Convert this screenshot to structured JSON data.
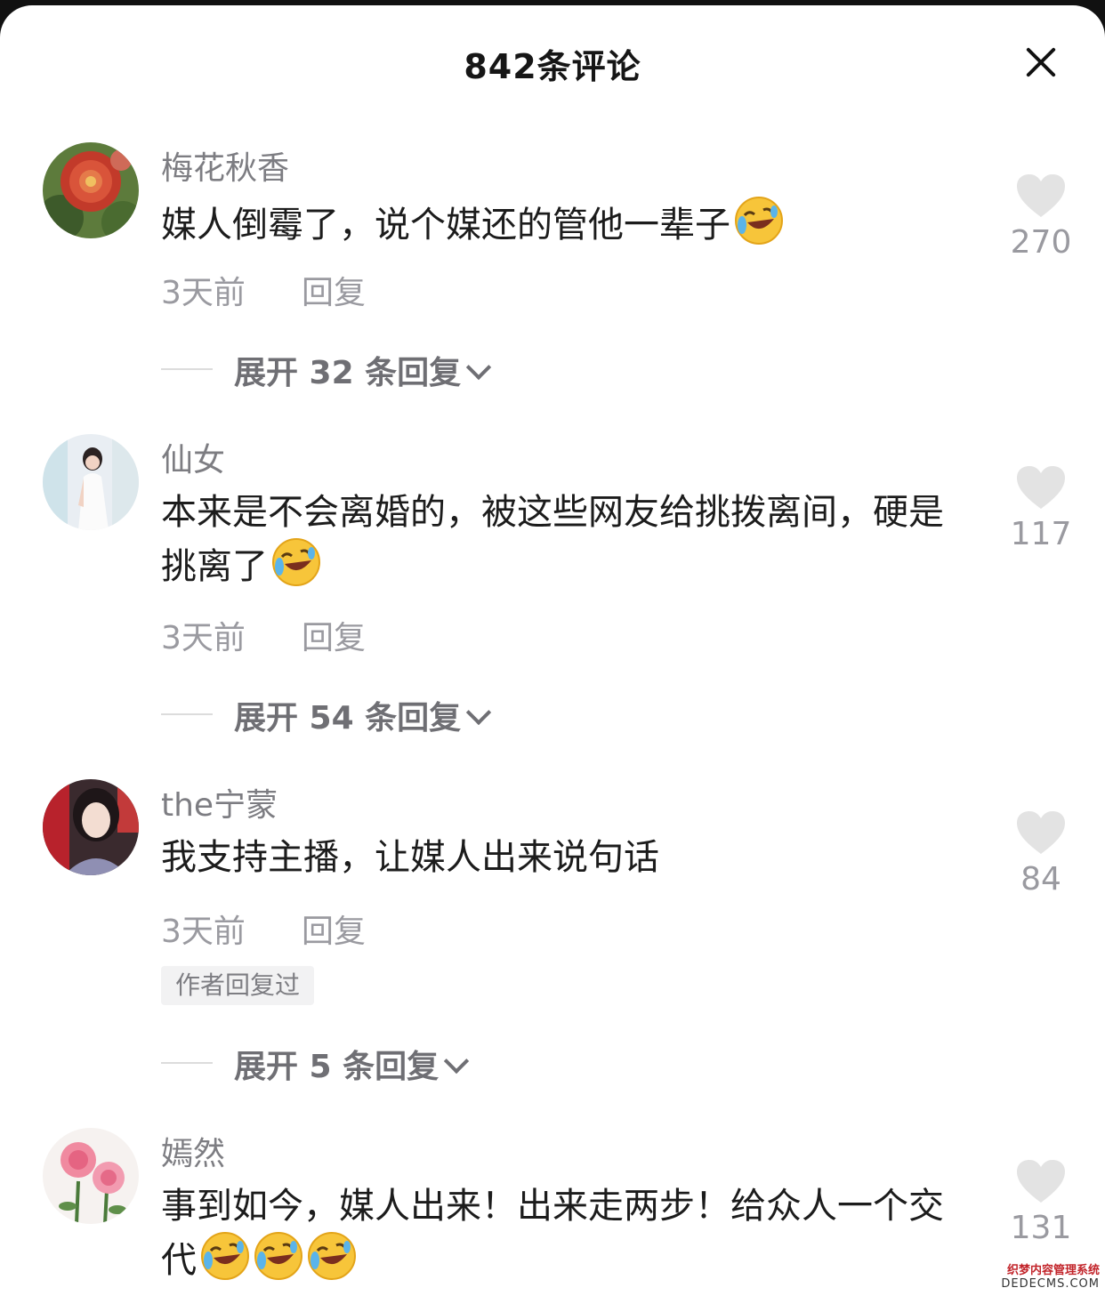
{
  "header": {
    "title": "842条评论"
  },
  "comments": [
    {
      "username": "梅花秋香",
      "text": "媒人倒霉了，说个媒还的管他一辈子",
      "emoji_count": 1,
      "time": "3天前",
      "reply_label": "回复",
      "likes": "270",
      "expand_label": "展开 32 条回复",
      "author_replied": "",
      "avatar_icon": "red-peony-avatar"
    },
    {
      "username": "仙女",
      "text": "本来是不会离婚的，被这些网友给挑拨离间，硬是挑离了",
      "emoji_count": 1,
      "time": "3天前",
      "reply_label": "回复",
      "likes": "117",
      "expand_label": "展开 54 条回复",
      "author_replied": "",
      "avatar_icon": "woman-white-dress-avatar"
    },
    {
      "username": "the宁蒙",
      "text": "我支持主播，让媒人出来说句话",
      "emoji_count": 0,
      "time": "3天前",
      "reply_label": "回复",
      "likes": "84",
      "expand_label": "展开 5 条回复",
      "author_replied": "作者回复过",
      "avatar_icon": "woman-portrait-avatar"
    },
    {
      "username": "嫣然",
      "text": "事到如今，媒人出来！出来走两步！给众人一个交代",
      "emoji_count": 3,
      "time": "",
      "reply_label": "",
      "likes": "131",
      "expand_label": "",
      "author_replied": "",
      "avatar_icon": "pink-roses-avatar"
    }
  ],
  "icons": {
    "close": "close-icon",
    "heart": "heart-icon",
    "emoji": "laughing-crying-emoji",
    "chevron": "chevron-down-icon"
  },
  "colors": {
    "background": "#ffffff",
    "username": "#7d7d82",
    "text": "#1c1c1c",
    "meta": "#9a9aa0",
    "heart": "#e3e3e3"
  },
  "watermark": {
    "line1": "织梦内容管理系统",
    "line2": "DEDECMS.COM"
  }
}
